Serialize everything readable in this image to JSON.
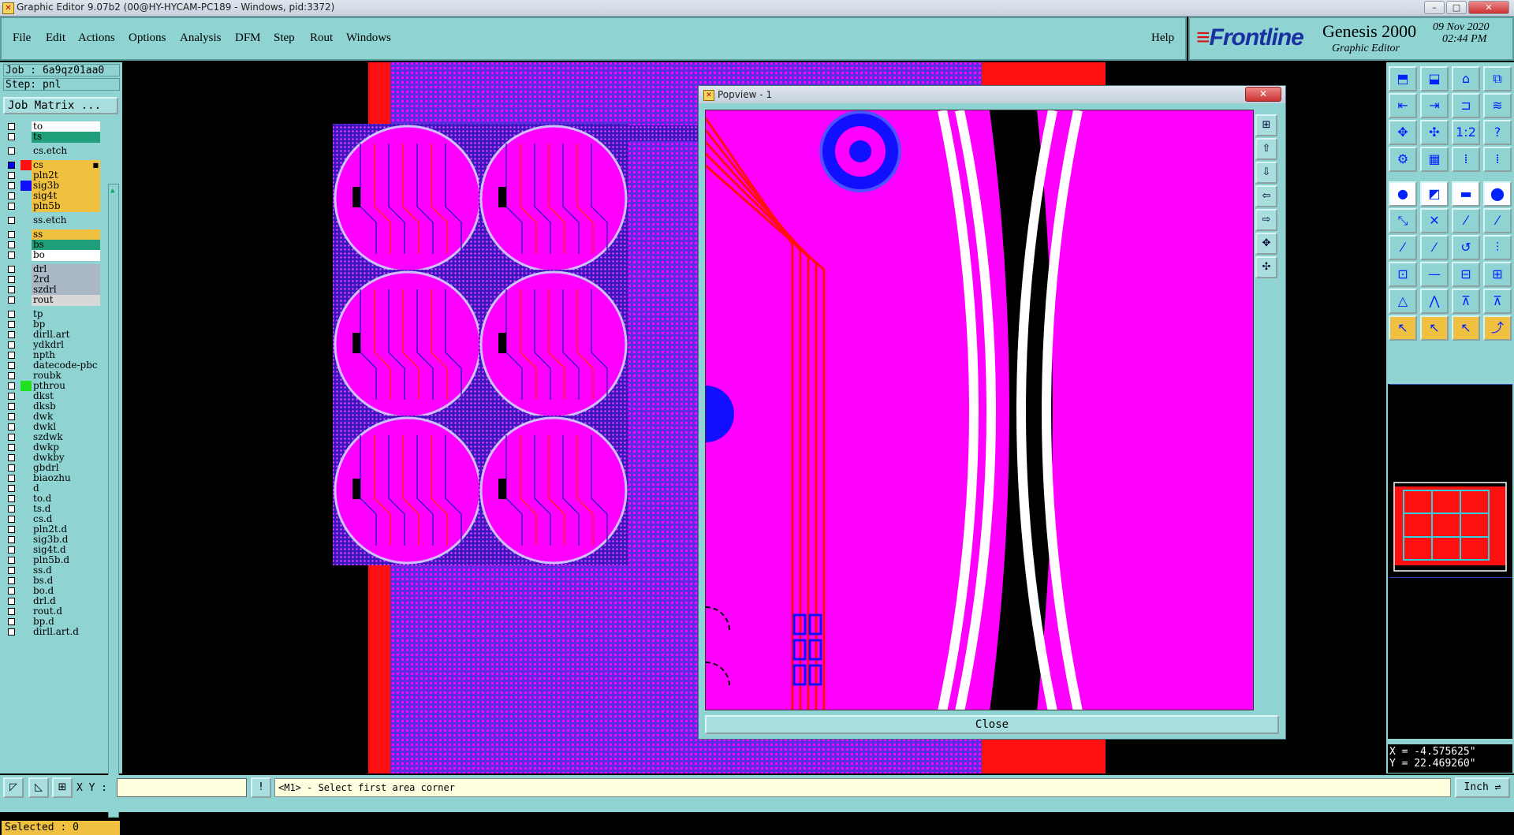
{
  "window": {
    "title": "Graphic Editor 9.07b2 (00@HY-HYCAM-PC189 - Windows, pid:3372)",
    "minimize": "–",
    "maximize": "□",
    "close": "✕"
  },
  "menu": [
    "File",
    "Edit",
    "Actions",
    "Options",
    "Analysis",
    "DFM",
    "Step",
    "Rout",
    "Windows"
  ],
  "help": "Help",
  "brand": {
    "name": "Frontline",
    "product": "Genesis 2000",
    "subtitle": "Graphic Editor",
    "date": "09 Nov 2020",
    "time": "02:44 PM"
  },
  "job": {
    "job_line": "Job : 6a9qz01aa0",
    "step_line": "Step: pnl",
    "matrix_button": "Job Matrix ..."
  },
  "layers": [
    {
      "name": "to",
      "color": "#ffffff",
      "checked": false,
      "sq": ""
    },
    {
      "name": "ts",
      "color": "#1fa07a",
      "checked": false,
      "sq": ""
    },
    {
      "name": "cs.etch",
      "color": "#8fd3d3",
      "checked": false,
      "sq": ""
    },
    {
      "name": "cs",
      "color": "#f0c040",
      "checked": true,
      "sq": "#ff1010",
      "flag": "■"
    },
    {
      "name": "pln2t",
      "color": "#f0c040",
      "checked": false,
      "sq": ""
    },
    {
      "name": "sig3b",
      "color": "#f0c040",
      "checked": false,
      "sq": "#1010ff"
    },
    {
      "name": "sig4t",
      "color": "#f0c040",
      "checked": false,
      "sq": ""
    },
    {
      "name": "pln5b",
      "color": "#f0c040",
      "checked": false,
      "sq": ""
    },
    {
      "name": "ss.etch",
      "color": "#8fd3d3",
      "checked": false,
      "sq": ""
    },
    {
      "name": "ss",
      "color": "#f0c040",
      "checked": false,
      "sq": ""
    },
    {
      "name": "bs",
      "color": "#1fa07a",
      "checked": false,
      "sq": ""
    },
    {
      "name": "bo",
      "color": "#ffffff",
      "checked": false,
      "sq": ""
    },
    {
      "name": "drl",
      "color": "#a9b8c4",
      "checked": false,
      "sq": ""
    },
    {
      "name": "2rd",
      "color": "#a9b8c4",
      "checked": false,
      "sq": ""
    },
    {
      "name": "szdrl",
      "color": "#a9b8c4",
      "checked": false,
      "sq": ""
    },
    {
      "name": "rout",
      "color": "#d8d8d8",
      "checked": false,
      "sq": ""
    },
    {
      "name": "tp",
      "color": "#8fd3d3",
      "checked": false,
      "sq": ""
    },
    {
      "name": "bp",
      "color": "#8fd3d3",
      "checked": false,
      "sq": ""
    },
    {
      "name": "dirll.art",
      "color": "#8fd3d3",
      "checked": false,
      "sq": ""
    },
    {
      "name": "ydkdrl",
      "color": "#8fd3d3",
      "checked": false,
      "sq": ""
    },
    {
      "name": "npth",
      "color": "#8fd3d3",
      "checked": false,
      "sq": ""
    },
    {
      "name": "datecode-pbc",
      "color": "#8fd3d3",
      "checked": false,
      "sq": ""
    },
    {
      "name": "roubk",
      "color": "#8fd3d3",
      "checked": false,
      "sq": ""
    },
    {
      "name": "pthrou",
      "color": "#8fd3d3",
      "checked": false,
      "sq": "#20e020"
    },
    {
      "name": "dkst",
      "color": "#8fd3d3",
      "checked": false,
      "sq": ""
    },
    {
      "name": "dksb",
      "color": "#8fd3d3",
      "checked": false,
      "sq": ""
    },
    {
      "name": "dwk",
      "color": "#8fd3d3",
      "checked": false,
      "sq": ""
    },
    {
      "name": "dwkl",
      "color": "#8fd3d3",
      "checked": false,
      "sq": ""
    },
    {
      "name": "szdwk",
      "color": "#8fd3d3",
      "checked": false,
      "sq": ""
    },
    {
      "name": "dwkp",
      "color": "#8fd3d3",
      "checked": false,
      "sq": ""
    },
    {
      "name": "dwkby",
      "color": "#8fd3d3",
      "checked": false,
      "sq": ""
    },
    {
      "name": "gbdrl",
      "color": "#8fd3d3",
      "checked": false,
      "sq": ""
    },
    {
      "name": "biaozhu",
      "color": "#8fd3d3",
      "checked": false,
      "sq": ""
    },
    {
      "name": "d",
      "color": "#8fd3d3",
      "checked": false,
      "sq": ""
    },
    {
      "name": "to.d",
      "color": "#8fd3d3",
      "checked": false,
      "sq": ""
    },
    {
      "name": "ts.d",
      "color": "#8fd3d3",
      "checked": false,
      "sq": ""
    },
    {
      "name": "cs.d",
      "color": "#8fd3d3",
      "checked": false,
      "sq": ""
    },
    {
      "name": "pln2t.d",
      "color": "#8fd3d3",
      "checked": false,
      "sq": ""
    },
    {
      "name": "sig3b.d",
      "color": "#8fd3d3",
      "checked": false,
      "sq": ""
    },
    {
      "name": "sig4t.d",
      "color": "#8fd3d3",
      "checked": false,
      "sq": ""
    },
    {
      "name": "pln5b.d",
      "color": "#8fd3d3",
      "checked": false,
      "sq": ""
    },
    {
      "name": "ss.d",
      "color": "#8fd3d3",
      "checked": false,
      "sq": ""
    },
    {
      "name": "bs.d",
      "color": "#8fd3d3",
      "checked": false,
      "sq": ""
    },
    {
      "name": "bo.d",
      "color": "#8fd3d3",
      "checked": false,
      "sq": ""
    },
    {
      "name": "drl.d",
      "color": "#8fd3d3",
      "checked": false,
      "sq": ""
    },
    {
      "name": "rout.d",
      "color": "#8fd3d3",
      "checked": false,
      "sq": ""
    },
    {
      "name": "bp.d",
      "color": "#8fd3d3",
      "checked": false,
      "sq": ""
    },
    {
      "name": "dirll.art.d",
      "color": "#8fd3d3",
      "checked": false,
      "sq": ""
    }
  ],
  "selected": "Selected : 0",
  "popview": {
    "title": "Popview - 1",
    "close_button": "Close"
  },
  "bottom": {
    "xy_label": "X Y :",
    "xy_value": "",
    "status": "<M1> - Select first area corner",
    "units": "Inch ⇌"
  },
  "coords": {
    "x": "X = -4.575625\"",
    "y": "Y = 22.469260\""
  },
  "colors": {
    "panel": "#8fd3d3",
    "layer_cs": "#ff1010",
    "pcb_magenta": "#ff00ff",
    "pcb_blue": "#1010ff"
  }
}
